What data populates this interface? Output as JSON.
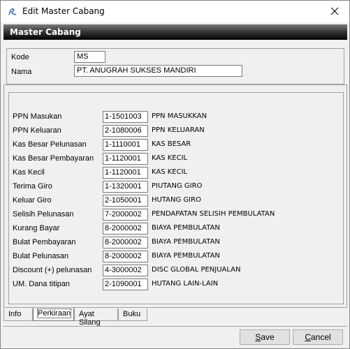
{
  "window": {
    "title": "Edit Master Cabang"
  },
  "header": {
    "title": "Master  Cabang"
  },
  "top": {
    "kode_label": "Kode",
    "kode_value": "MS",
    "nama_label": "Nama",
    "nama_value": "PT. ANUGRAH SUKSES MANDIRI"
  },
  "rows": [
    {
      "label": "PPN Masukan",
      "code": "1-1501003",
      "desc": "PPN MASUKKAN"
    },
    {
      "label": "PPN Keluaran",
      "code": "2-1080006",
      "desc": "PPN KELUARAN"
    },
    {
      "label": "Kas Besar Pelunasan",
      "code": "1-1110001",
      "desc": "KAS BESAR"
    },
    {
      "label": "Kas Besar Pembayaran",
      "code": "1-1120001",
      "desc": "KAS KECIL"
    },
    {
      "label": "Kas Kecil",
      "code": "1-1120001",
      "desc": "KAS KECIL"
    },
    {
      "label": "Terima Giro",
      "code": "1-1320001",
      "desc": "PIUTANG GIRO"
    },
    {
      "label": "Keluar Giro",
      "code": "2-1050001",
      "desc": "HUTANG GIRO"
    },
    {
      "label": "Selisih Pelunasan",
      "code": "7-2000002",
      "desc": "PENDAPATAN SELISIH PEMBULATAN"
    },
    {
      "label": "Kurang Bayar",
      "code": "8-2000002",
      "desc": "BIAYA PEMBULATAN"
    },
    {
      "label": "Bulat Pembayaran",
      "code": "8-2000002",
      "desc": "BIAYA PEMBULATAN"
    },
    {
      "label": "Bulat Pelunasan",
      "code": "8-2000002",
      "desc": "BIAYA PEMBULATAN"
    },
    {
      "label": "Discount (+) pelunasan",
      "code": "4-3000002",
      "desc": "DISC GLOBAL  PENJUALAN"
    },
    {
      "label": "UM. Dana titipan",
      "code": "2-1090001",
      "desc": "HUTANG LAIN-LAIN"
    }
  ],
  "tabs": [
    "Info",
    "Perkiraan",
    "Ayat Silang",
    "Buku"
  ],
  "active_tab": "Perkiraan",
  "buttons": {
    "save_ul": "S",
    "save_rest": "ave",
    "cancel_ul": "C",
    "cancel_rest": "ancel"
  }
}
